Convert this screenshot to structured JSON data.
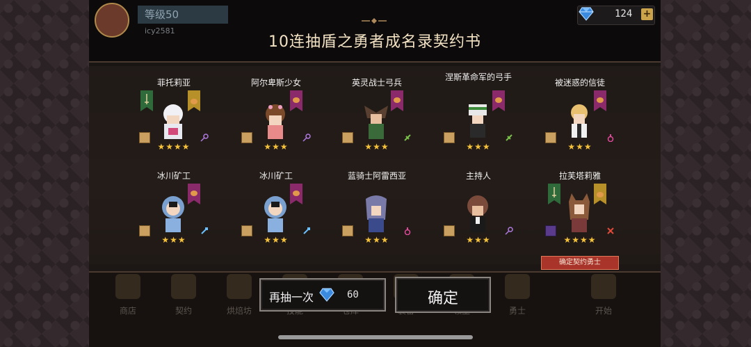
{
  "header": {
    "level_text": "等级50",
    "username": "icy2581",
    "gem_count": "124",
    "plus_label": "+"
  },
  "dialog": {
    "title": "10连抽盾之勇者成名录契约书",
    "confirm_tag": "确定契约勇士",
    "draw_again_label": "再抽一次",
    "draw_again_cost": "60",
    "confirm_label": "确定"
  },
  "cards": [
    {
      "name": "菲托莉亚",
      "stars": "★★★★",
      "attr": "key-icon"
    },
    {
      "name": "阿尔卑斯少女",
      "stars": "★★★",
      "attr": "key-icon"
    },
    {
      "name": "英灵战士弓兵",
      "stars": "★★★",
      "attr": "leaf-icon"
    },
    {
      "name": "涅斯革命军的弓手",
      "stars": "★★★",
      "attr": "leaf-icon"
    },
    {
      "name": "被迷惑的信徒",
      "stars": "★★★",
      "attr": "potion-icon"
    },
    {
      "name": "冰川矿工",
      "stars": "★★★",
      "attr": "ice-icon"
    },
    {
      "name": "冰川矿工",
      "stars": "★★★",
      "attr": "ice-icon"
    },
    {
      "name": "蓝骑士阿雷西亚",
      "stars": "★★★",
      "attr": "potion-icon"
    },
    {
      "name": "主持人",
      "stars": "★★★",
      "attr": "key-icon"
    },
    {
      "name": "拉芙塔莉雅",
      "stars": "★★★★",
      "attr": "sword-icon"
    }
  ],
  "nav": [
    "商店",
    "契约",
    "烘焙坊",
    "技能",
    "仓库",
    "装备",
    "领主",
    "勇士",
    "开始"
  ],
  "colors": {
    "banner": "#8a2a6a",
    "banner_green": "#2f6a3a",
    "banner_gold": "#b8902a",
    "star": "#f6c23a",
    "gem": "#3a8ae0",
    "tag": "#a8342a"
  }
}
